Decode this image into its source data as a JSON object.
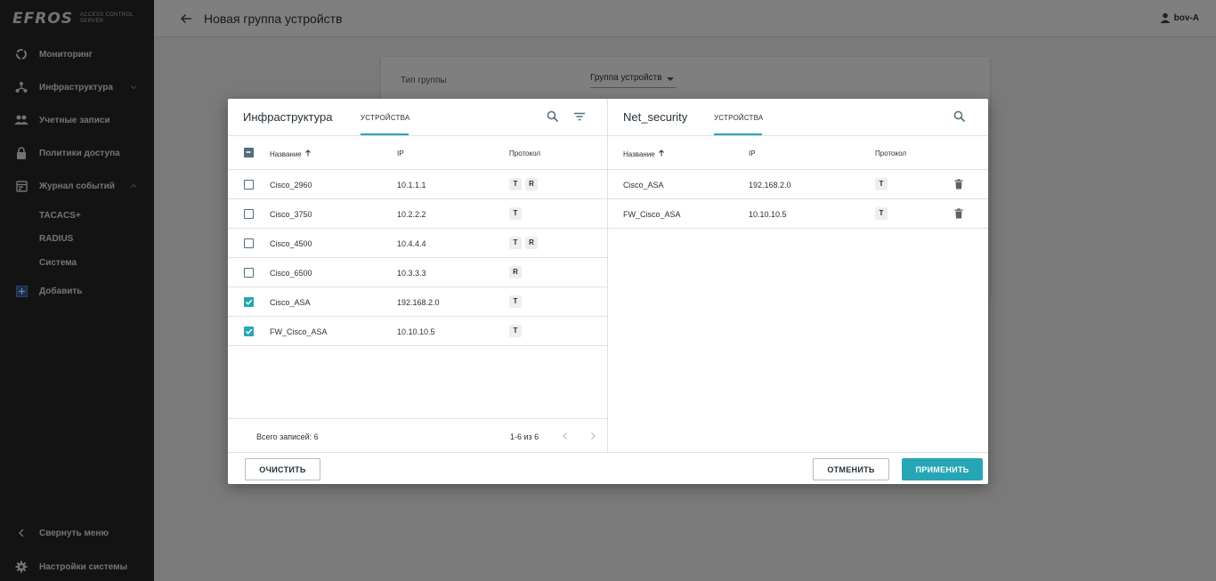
{
  "app": {
    "logo_text": "EFROS",
    "logo_sub": "ACCESS CONTROL SERVER"
  },
  "sidebar": {
    "items": [
      {
        "label": "Мониторинг",
        "icon": "monitoring-icon"
      },
      {
        "label": "Инфраструктура",
        "icon": "infrastructure-icon",
        "expandable": true
      },
      {
        "label": "Учетные записи",
        "icon": "accounts-icon"
      },
      {
        "label": "Политики доступа",
        "icon": "lock-icon"
      },
      {
        "label": "Журнал событий",
        "icon": "journal-icon",
        "expanded": true
      },
      {
        "label": "Добавить",
        "icon": "add-icon"
      }
    ],
    "sub_items": [
      "TACACS+",
      "RADIUS",
      "Система"
    ],
    "collapse_label": "Свернуть меню",
    "settings_label": "Настройки системы"
  },
  "header": {
    "title": "Новая группа устройств",
    "user": "bov-A"
  },
  "background_form": {
    "type_label": "Тип группы",
    "type_value": "Группа устройств"
  },
  "dialog": {
    "left": {
      "title": "Инфраструктура",
      "tab": "УСТРОЙСТВА",
      "columns": [
        "Название",
        "IP",
        "Протокол"
      ],
      "rows": [
        {
          "name": "Cisco_2960",
          "ip": "10.1.1.1",
          "protocols": [
            "T",
            "R"
          ],
          "checked": false
        },
        {
          "name": "Cisco_3750",
          "ip": "10.2.2.2",
          "protocols": [
            "T"
          ],
          "checked": false
        },
        {
          "name": "Cisco_4500",
          "ip": "10.4.4.4",
          "protocols": [
            "T",
            "R"
          ],
          "checked": false
        },
        {
          "name": "Cisco_6500",
          "ip": "10.3.3.3",
          "protocols": [
            "R"
          ],
          "checked": false
        },
        {
          "name": "Cisco_ASA",
          "ip": "192.168.2.0",
          "protocols": [
            "T"
          ],
          "checked": true
        },
        {
          "name": "FW_Cisco_ASA",
          "ip": "10.10.10.5",
          "protocols": [
            "T"
          ],
          "checked": true
        }
      ],
      "total": "Всего записей: 6",
      "pagination": "1-6 из 6"
    },
    "right": {
      "title": "Net_security",
      "tab": "УСТРОЙСТВА",
      "columns": [
        "Название",
        "IP",
        "Протокол"
      ],
      "rows": [
        {
          "name": "Cisco_ASA",
          "ip": "192.168.2.0",
          "protocols": [
            "T"
          ]
        },
        {
          "name": "FW_Cisco_ASA",
          "ip": "10.10.10.5",
          "protocols": [
            "T"
          ]
        }
      ]
    },
    "buttons": {
      "clear": "ОЧИСТИТЬ",
      "cancel": "ОТМЕНИТЬ",
      "apply": "ПРИМЕНИТЬ"
    }
  },
  "colors": {
    "sidebar_bg": "#262626",
    "accent": "#26a6b5"
  }
}
